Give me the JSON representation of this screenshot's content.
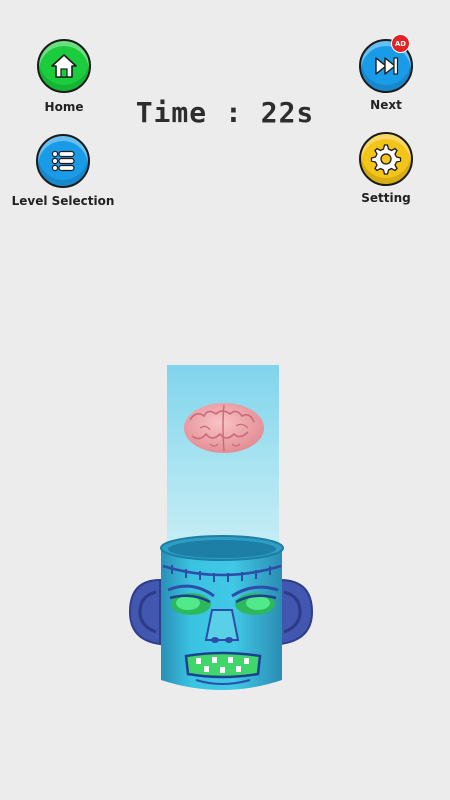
{
  "hud": {
    "timer_text": "Time : 22s"
  },
  "buttons": {
    "home_label": "Home",
    "levels_label": "Level Selection",
    "next_label": "Next",
    "next_badge": "AD",
    "setting_label": "Setting"
  },
  "colors": {
    "home": "#1bcc3c",
    "levels": "#1a9be8",
    "next": "#1a9be8",
    "setting": "#f4c518",
    "beam": "#8dd9ee",
    "monster_body": "#3bc1df",
    "monster_ears": "#4257b0",
    "eyes": "#3fe07a",
    "brain": "#f0a9ae"
  },
  "icons": {
    "home": "house-icon",
    "levels": "list-icon",
    "next": "skip-forward-icon",
    "setting": "gear-icon"
  }
}
